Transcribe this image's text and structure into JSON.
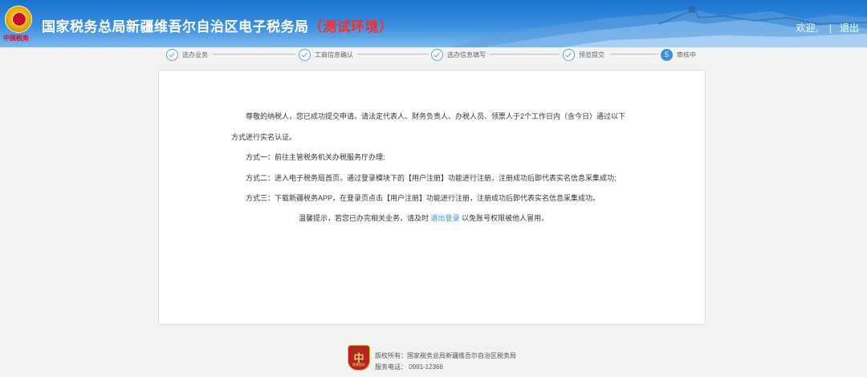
{
  "header": {
    "emblem_caption": "中国税务",
    "title": "国家税务总局新疆维吾尔自治区电子税务局",
    "env_label": "（测试环境）",
    "welcome": "欢迎,",
    "separator": "|",
    "logout": "退出"
  },
  "steps": [
    {
      "label": "选办业务",
      "state": "done"
    },
    {
      "label": "工商信息确认",
      "state": "done"
    },
    {
      "label": "选办信息填写",
      "state": "done"
    },
    {
      "label": "预览提交",
      "state": "done"
    },
    {
      "number": "5",
      "label": "审核中",
      "state": "active"
    }
  ],
  "notice": {
    "line1": "尊敬的纳税人，您已成功提交申请。请法定代表人、财务负责人、办税人员、领票人于2个工作日内（含今日）通过以下",
    "line2": "方式进行实名认证。",
    "method1": "方式一：前往主管税务机关办税服务厅办理;",
    "method2": "方式二：进入电子税务局首页，通过登录模块下的【用户注册】功能进行注册，注册成功后即代表实名信息采集成功;",
    "method3": "方式三：下载新疆税务APP，在登录页点击【用户注册】功能进行注册，注册成功后即代表实名信息采集成功。",
    "reminder_prefix": "温馨提示，若您已办完相关业务，请及时",
    "reminder_link": "退出登录",
    "reminder_suffix": "以免账号权限被他人冒用。"
  },
  "footer": {
    "logo_glyph": "中",
    "logo_caption": "智慧税务",
    "copyright": "版权所有：国家税务总局新疆维吾尔自治区税务局",
    "phone": "服务电话：  0991-12366"
  },
  "colors": {
    "header_blue": "#1a72cc",
    "accent": "#3b8fe0",
    "env_red": "#ff2b2b"
  }
}
